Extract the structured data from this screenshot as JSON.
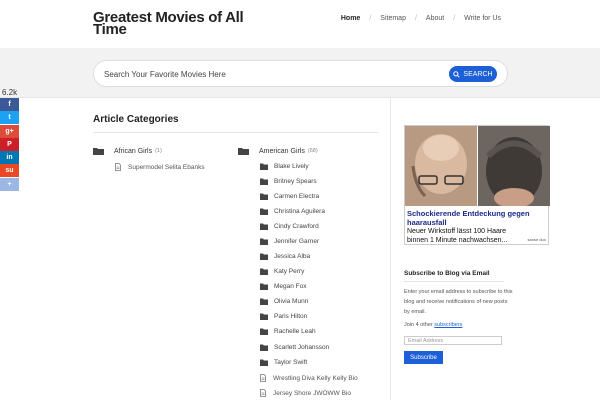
{
  "site": {
    "title": "Greatest Movies of All Time"
  },
  "nav": {
    "items": [
      {
        "label": "Home"
      },
      {
        "label": "Sitemap"
      },
      {
        "label": "About"
      },
      {
        "label": "Write for Us"
      }
    ]
  },
  "search": {
    "placeholder": "Search Your Favorite Movies Here",
    "button_label": "SEARCH"
  },
  "share": {
    "count": "6.2k",
    "buttons": [
      {
        "icon": "facebook-icon",
        "glyph": "f",
        "color": "#3b5998"
      },
      {
        "icon": "twitter-icon",
        "glyph": "t",
        "color": "#1da1f2"
      },
      {
        "icon": "google-plus-icon",
        "glyph": "g+",
        "color": "#dd4b39"
      },
      {
        "icon": "pinterest-icon",
        "glyph": "P",
        "color": "#cb2027"
      },
      {
        "icon": "linkedin-icon",
        "glyph": "in",
        "color": "#0077b5"
      },
      {
        "icon": "stumbleupon-icon",
        "glyph": "su",
        "color": "#eb4924"
      },
      {
        "icon": "share-more-icon",
        "glyph": "+",
        "color": "#9db7e4"
      }
    ]
  },
  "main": {
    "title": "Article Categories",
    "left": {
      "name": "African Girls",
      "count": "(1)",
      "posts": [
        "Supermodel Selita Ebanks"
      ]
    },
    "right": {
      "name": "American Girls",
      "count": "(68)",
      "subcategories": [
        "Blake Lively",
        "Britney Spears",
        "Carmen Electra",
        "Christina Aguilera",
        "Cindy Crawford",
        "Jennifer Garner",
        "Jessica Alba",
        "Katy Perry",
        "Megan Fox",
        "Olivia Munn",
        "Paris Hilton",
        "Rachelle Leah",
        "Scarlett Johansson",
        "Taylor Swift"
      ],
      "posts": [
        "Wrestling Diva Kelly Kelly Bio",
        "Jersey Shore JWOWW Bio"
      ]
    }
  },
  "ad": {
    "headline": "Schockierende Entdeckung gegen haarausfall",
    "body": "Neuer Wirkstoff lässt 100 Haare binnen 1 Minute nachwachsen...",
    "brand": "sanse duo"
  },
  "subscribe": {
    "title": "Subscribe to Blog via Email",
    "description": "Enter your email address to subscribe to this blog and receive notifications of new posts by email.",
    "join_prefix": "Join 4 other",
    "join_link": "subscribers",
    "email_placeholder": "Email Address",
    "button_label": "Subscribe"
  },
  "colors": {
    "accent": "#1c5fd6",
    "folder": "#444444"
  }
}
